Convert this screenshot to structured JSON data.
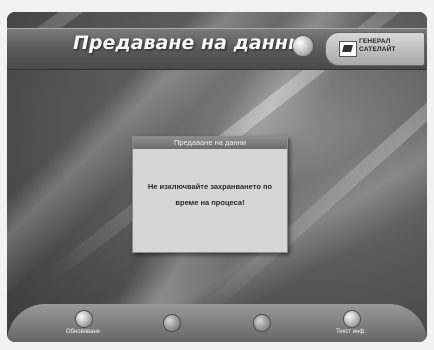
{
  "screen": {
    "title": "Предаване на данни",
    "brand": {
      "line1": "ГЕНЕРАЛ",
      "line2": "САТЕЛАЙТ"
    }
  },
  "dialog": {
    "title": "Предаване на данни",
    "message": "Не изключвайте захранването по време на процеса!"
  },
  "function_keys": [
    {
      "label": "Обновяване",
      "icon": "red-key-icon"
    },
    {
      "label": "",
      "icon": "green-key-icon"
    },
    {
      "label": "",
      "icon": "yellow-key-icon"
    },
    {
      "label": "Текст инф.",
      "icon": "blue-key-icon"
    }
  ]
}
